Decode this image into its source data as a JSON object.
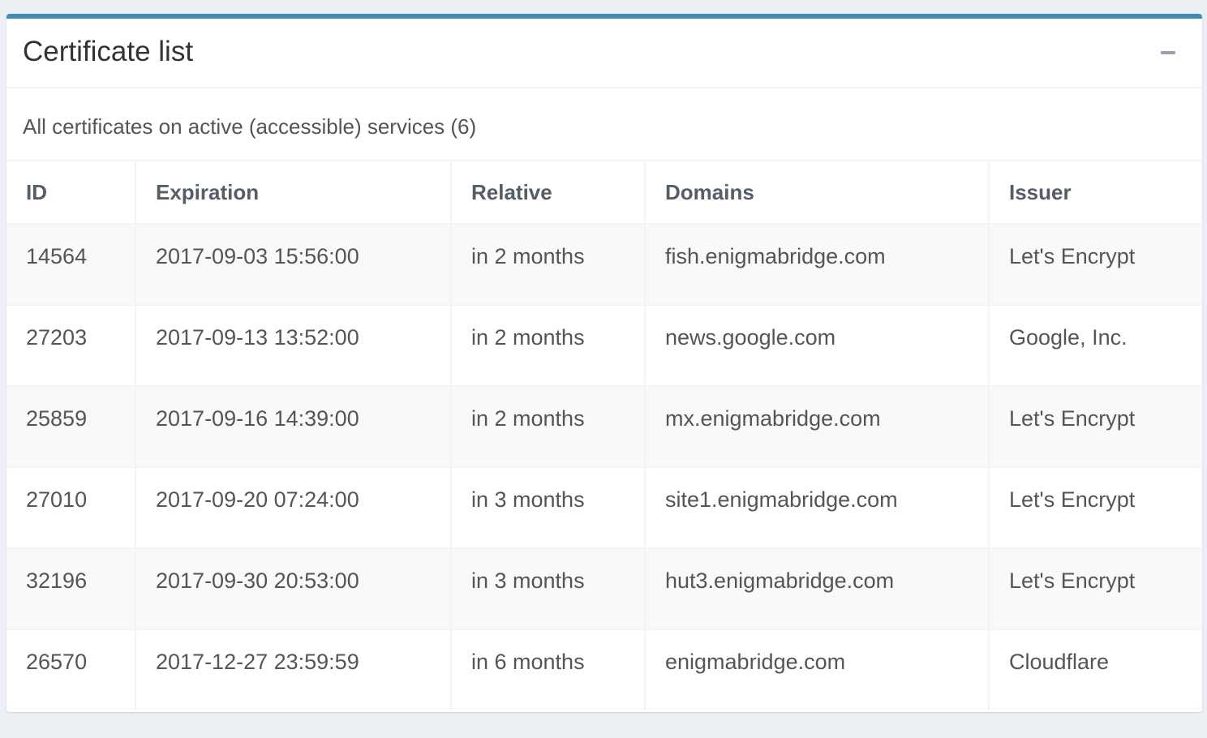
{
  "box": {
    "title": "Certificate list",
    "collapse_icon": "minus-icon",
    "subtitle": "All certificates on active (accessible) services (6)",
    "accent_color": "#3c8dbc"
  },
  "table": {
    "columns": [
      "ID",
      "Expiration",
      "Relative",
      "Domains",
      "Issuer"
    ],
    "rows": [
      [
        "14564",
        "2017-09-03 15:56:00",
        "in 2 months",
        "fish.enigmabridge.com",
        "Let's Encrypt"
      ],
      [
        "27203",
        "2017-09-13 13:52:00",
        "in 2 months",
        "news.google.com",
        "Google, Inc."
      ],
      [
        "25859",
        "2017-09-16 14:39:00",
        "in 2 months",
        "mx.enigmabridge.com",
        "Let's Encrypt"
      ],
      [
        "27010",
        "2017-09-20 07:24:00",
        "in 3 months",
        "site1.enigmabridge.com",
        "Let's Encrypt"
      ],
      [
        "32196",
        "2017-09-30 20:53:00",
        "in 3 months",
        "hut3.enigmabridge.com",
        "Let's Encrypt"
      ],
      [
        "26570",
        "2017-12-27 23:59:59",
        "in 6 months",
        "enigmabridge.com",
        "Cloudflare"
      ]
    ]
  }
}
